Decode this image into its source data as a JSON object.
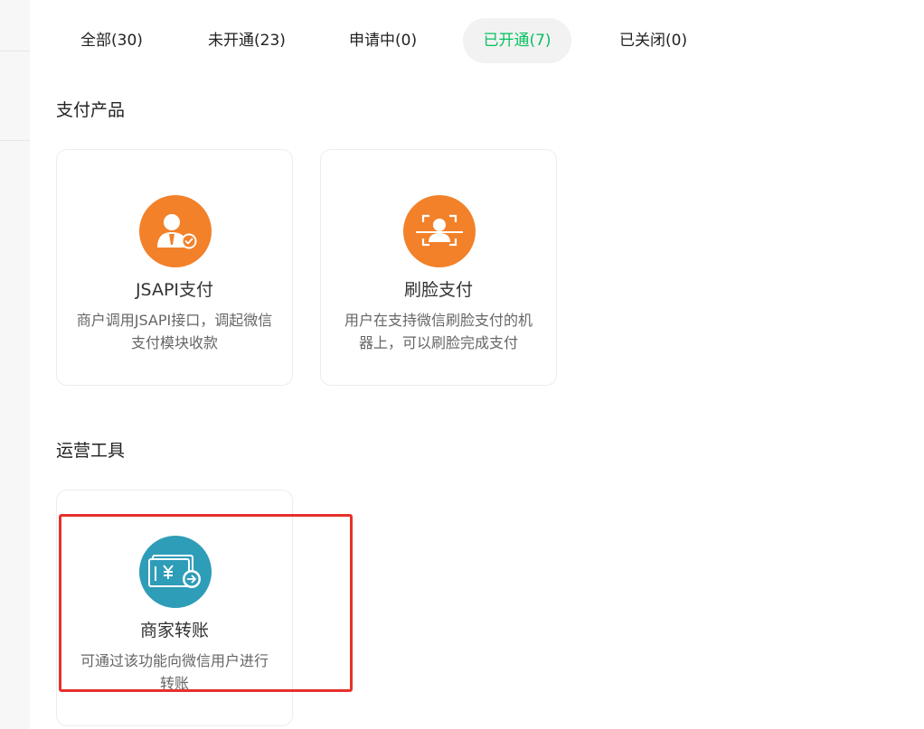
{
  "tabs": [
    {
      "label": "全部(30)",
      "active": false
    },
    {
      "label": "未开通(23)",
      "active": false
    },
    {
      "label": "申请中(0)",
      "active": false
    },
    {
      "label": "已开通(7)",
      "active": true
    },
    {
      "label": "已关闭(0)",
      "active": false
    }
  ],
  "sections": {
    "payment": {
      "title": "支付产品",
      "cards": [
        {
          "title": "JSAPI支付",
          "desc": "商户调用JSAPI接口，调起微信支付模块收款",
          "icon": "user-check-icon"
        },
        {
          "title": "刷脸支付",
          "desc": "用户在支持微信刷脸支付的机器上，可以刷脸完成支付",
          "icon": "face-scan-icon"
        }
      ]
    },
    "operations": {
      "title": "运营工具",
      "cards": [
        {
          "title": "商家转账",
          "desc": "可通过该功能向微信用户进行转账",
          "icon": "yuan-transfer-icon"
        }
      ]
    }
  },
  "colors": {
    "accent": "#07c160",
    "icon_orange": "#f2812a",
    "icon_teal": "#2e9db8",
    "highlight": "#e8302b"
  }
}
